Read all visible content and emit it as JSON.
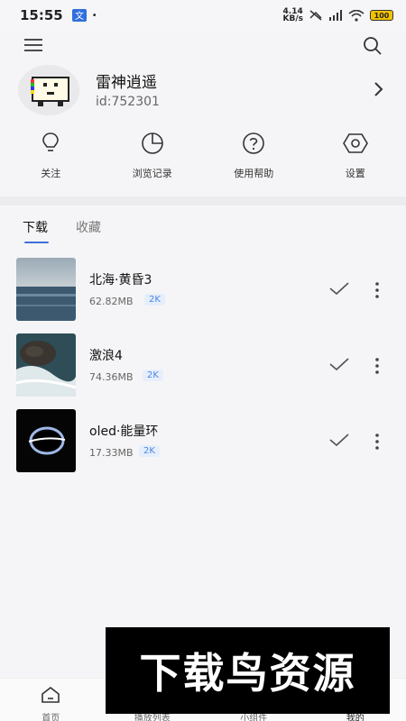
{
  "status_bar": {
    "time": "15:55",
    "net_speed_value": "4.14",
    "net_speed_unit": "KB/s",
    "battery": "100"
  },
  "profile": {
    "username": "雷神逍遥",
    "user_id": "id:752301"
  },
  "quick_actions": [
    {
      "label": "关注",
      "icon": "lightbulb-icon"
    },
    {
      "label": "浏览记录",
      "icon": "pie-chart-icon"
    },
    {
      "label": "使用帮助",
      "icon": "help-circle-icon"
    },
    {
      "label": "设置",
      "icon": "settings-eye-icon"
    }
  ],
  "tabs": {
    "downloads": "下载",
    "favorites": "收藏",
    "active": "下载"
  },
  "items": [
    {
      "title": "北海·黄昏3",
      "size": "62.82MB",
      "badge": "2K"
    },
    {
      "title": "激浪4",
      "size": "74.36MB",
      "badge": "2K"
    },
    {
      "title": "oled·能量环",
      "size": "17.33MB",
      "badge": "2K"
    }
  ],
  "bottom_nav": [
    {
      "label": "首页",
      "icon": "home-icon"
    },
    {
      "label": "播放列表",
      "icon": "playlist-icon"
    },
    {
      "label": "小组件",
      "icon": "widget-icon"
    },
    {
      "label": "我的",
      "icon": "profile-icon"
    }
  ],
  "watermark": {
    "text": "下载鸟资源"
  },
  "colors": {
    "accent": "#3f6fd8",
    "badge_bg": "#e6eefb",
    "badge_text": "#4a86e8"
  }
}
